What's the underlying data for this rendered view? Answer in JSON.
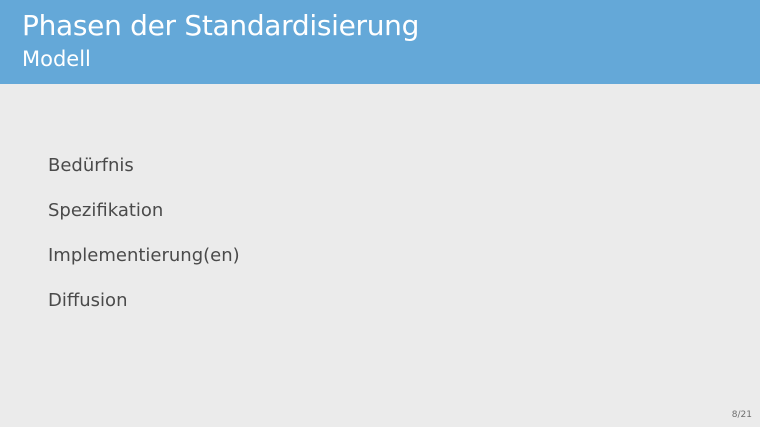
{
  "slide": {
    "title": "Phasen der Standardisierung",
    "subtitle": "Modell",
    "phases": [
      "Bedürfnis",
      "Spezifikation",
      "Implementierung(en)",
      "Diffusion"
    ],
    "page_number": "8/21"
  },
  "colors": {
    "header_background": "#64a8d8",
    "slide_background": "#ebebeb",
    "header_text": "#ffffff",
    "body_text": "#4a4a4a"
  }
}
